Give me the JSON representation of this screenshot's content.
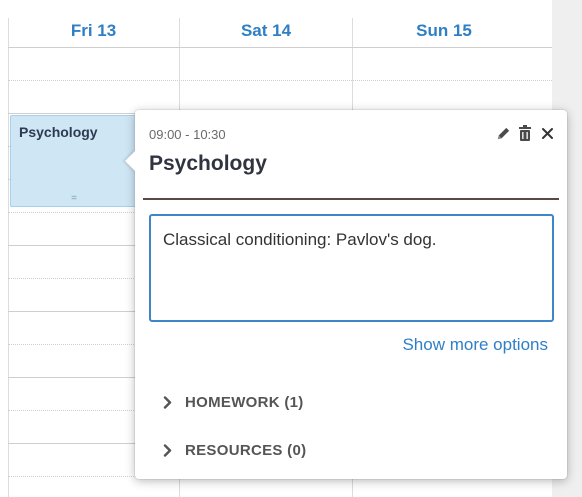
{
  "calendar": {
    "days": [
      "Fri 13",
      "Sat 14",
      "Sun 15"
    ],
    "event": {
      "title": "Psychology",
      "handle": "="
    }
  },
  "popover": {
    "time": "09:00 - 10:30",
    "title": "Psychology",
    "icons": [
      "pencil-icon",
      "trash-icon",
      "close-icon"
    ],
    "notes_value": "Classical conditioning: Pavlov's dog.",
    "show_more": "Show more options",
    "sections": [
      {
        "label": "HOMEWORK (1)"
      },
      {
        "label": "RESOURCES (0)"
      }
    ]
  },
  "colors": {
    "accent": "#2f7fc6",
    "event_bg": "#cfe6f5",
    "divider": "#5a4747"
  }
}
